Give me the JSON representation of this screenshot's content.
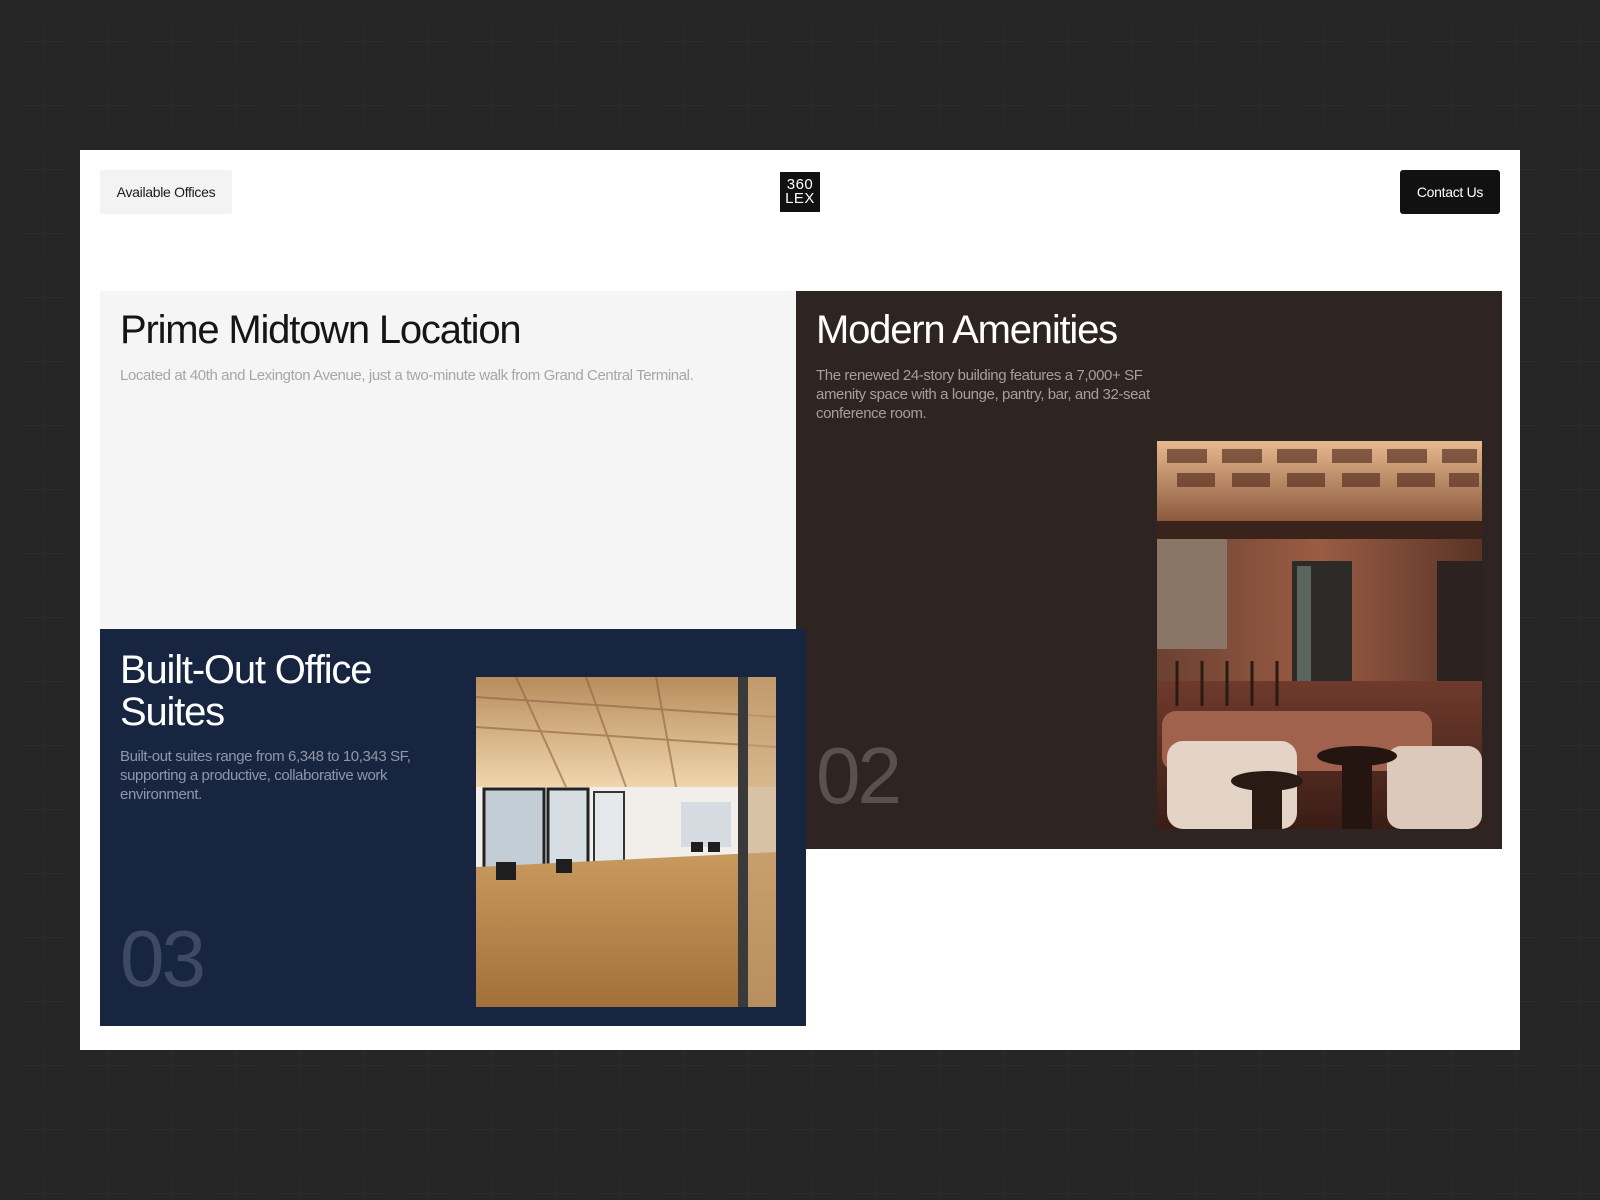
{
  "header": {
    "available_label": "Available Offices",
    "logo_line1": "360",
    "logo_line2": "LEX",
    "contact_label": "Contact Us"
  },
  "cards": {
    "location": {
      "title": "Prime Midtown Location",
      "description": "Located at 40th and Lexington Avenue, just a two-minute walk from Grand Central Terminal."
    },
    "amenities": {
      "title": "Modern Amenities",
      "description": "The renewed 24-story building features a 7,000+ SF amenity space with a lounge, pantry, bar, and 32-seat conference room.",
      "number": "02"
    },
    "suites": {
      "title": "Built-Out Office Suites",
      "description": "Built-out suites range from 6,348 to 10,343 SF, supporting a productive, collaborative work environment.",
      "number": "03"
    }
  },
  "colors": {
    "page_bg": "#141414",
    "location_card": "#f5f5f5",
    "amenities_card": "#2e2421",
    "suites_card": "#182540"
  }
}
